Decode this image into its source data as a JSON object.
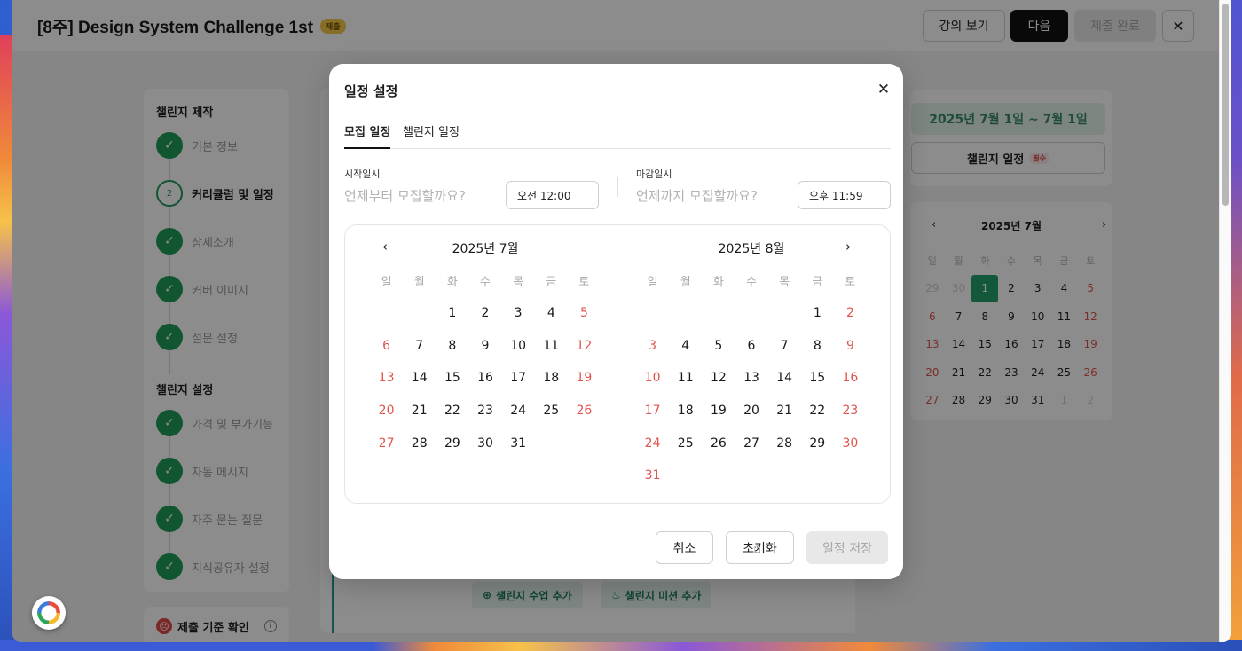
{
  "app": {
    "title": "[8주] Design System Challenge 1st",
    "title_badge": "제출",
    "buttons": {
      "lecture": "강의 보기",
      "next": "다음",
      "submit": "제출 완료",
      "close": "✕"
    }
  },
  "sidebar": {
    "section1": "챌린지 제작",
    "section2": "챌린지 설정",
    "items1": [
      {
        "label": "기본 정보",
        "state": "done"
      },
      {
        "label": "커리큘럼 및 일정",
        "state": "current",
        "step": "2"
      },
      {
        "label": "상세소개",
        "state": "done"
      },
      {
        "label": "커버 이미지",
        "state": "done"
      },
      {
        "label": "설문 설정",
        "state": "done"
      }
    ],
    "items2": [
      {
        "label": "가격 및 부가기능",
        "state": "done"
      },
      {
        "label": "자동 메시지",
        "state": "done"
      },
      {
        "label": "자주 묻는 질문",
        "state": "done"
      },
      {
        "label": "지식공유자 설정",
        "state": "done"
      }
    ],
    "check_glyph": "✓",
    "criteria": "제출 기준 확인"
  },
  "center": {
    "add_lesson": "챌린지 수업 추가",
    "add_mission": "챌린지 미션 추가"
  },
  "right": {
    "range": "2025년 7월 1일 ~ 7월 1일",
    "schedule_button": "챌린지 일정",
    "required_badge": "필수",
    "mini_calendar": {
      "month": "2025년 7월",
      "weekdays": [
        "일",
        "월",
        "화",
        "수",
        "목",
        "금",
        "토"
      ],
      "days": [
        {
          "d": "29",
          "t": "muted"
        },
        {
          "d": "30",
          "t": "muted"
        },
        {
          "d": "1",
          "t": "sel"
        },
        {
          "d": "2",
          "t": ""
        },
        {
          "d": "3",
          "t": ""
        },
        {
          "d": "4",
          "t": ""
        },
        {
          "d": "5",
          "t": "red"
        },
        {
          "d": "6",
          "t": "red"
        },
        {
          "d": "7",
          "t": ""
        },
        {
          "d": "8",
          "t": ""
        },
        {
          "d": "9",
          "t": ""
        },
        {
          "d": "10",
          "t": ""
        },
        {
          "d": "11",
          "t": ""
        },
        {
          "d": "12",
          "t": "red"
        },
        {
          "d": "13",
          "t": "red"
        },
        {
          "d": "14",
          "t": ""
        },
        {
          "d": "15",
          "t": ""
        },
        {
          "d": "16",
          "t": ""
        },
        {
          "d": "17",
          "t": ""
        },
        {
          "d": "18",
          "t": ""
        },
        {
          "d": "19",
          "t": "red"
        },
        {
          "d": "20",
          "t": "red"
        },
        {
          "d": "21",
          "t": ""
        },
        {
          "d": "22",
          "t": ""
        },
        {
          "d": "23",
          "t": ""
        },
        {
          "d": "24",
          "t": ""
        },
        {
          "d": "25",
          "t": ""
        },
        {
          "d": "26",
          "t": "red"
        },
        {
          "d": "27",
          "t": "red"
        },
        {
          "d": "28",
          "t": ""
        },
        {
          "d": "29",
          "t": ""
        },
        {
          "d": "30",
          "t": ""
        },
        {
          "d": "31",
          "t": ""
        },
        {
          "d": "1",
          "t": "muted"
        },
        {
          "d": "2",
          "t": "muted"
        }
      ]
    }
  },
  "modal": {
    "title": "일정 설정",
    "close": "✕",
    "tabs": [
      "모집 일정",
      "챌린지 일정"
    ],
    "start": {
      "label": "시작일시",
      "hint": "언제부터 모집할까요?",
      "time": "오전 12:00"
    },
    "end": {
      "label": "마감일시",
      "hint": "언제까지 모집할까요?",
      "time": "오후 11:59"
    },
    "weekdays": [
      "일",
      "월",
      "화",
      "수",
      "목",
      "금",
      "토"
    ],
    "calendars": [
      {
        "month": "2025년 7월",
        "offset": 2,
        "days": 31
      },
      {
        "month": "2025년 8월",
        "offset": 5,
        "days": 31
      }
    ],
    "nav_prev": "‹",
    "nav_next": "›",
    "buttons": {
      "cancel": "취소",
      "reset": "초기화",
      "save": "일정 저장"
    }
  },
  "colors": {
    "accent_green": "#1f9c5a",
    "weekend_red": "#e0554f",
    "selected": "#24a06a"
  }
}
